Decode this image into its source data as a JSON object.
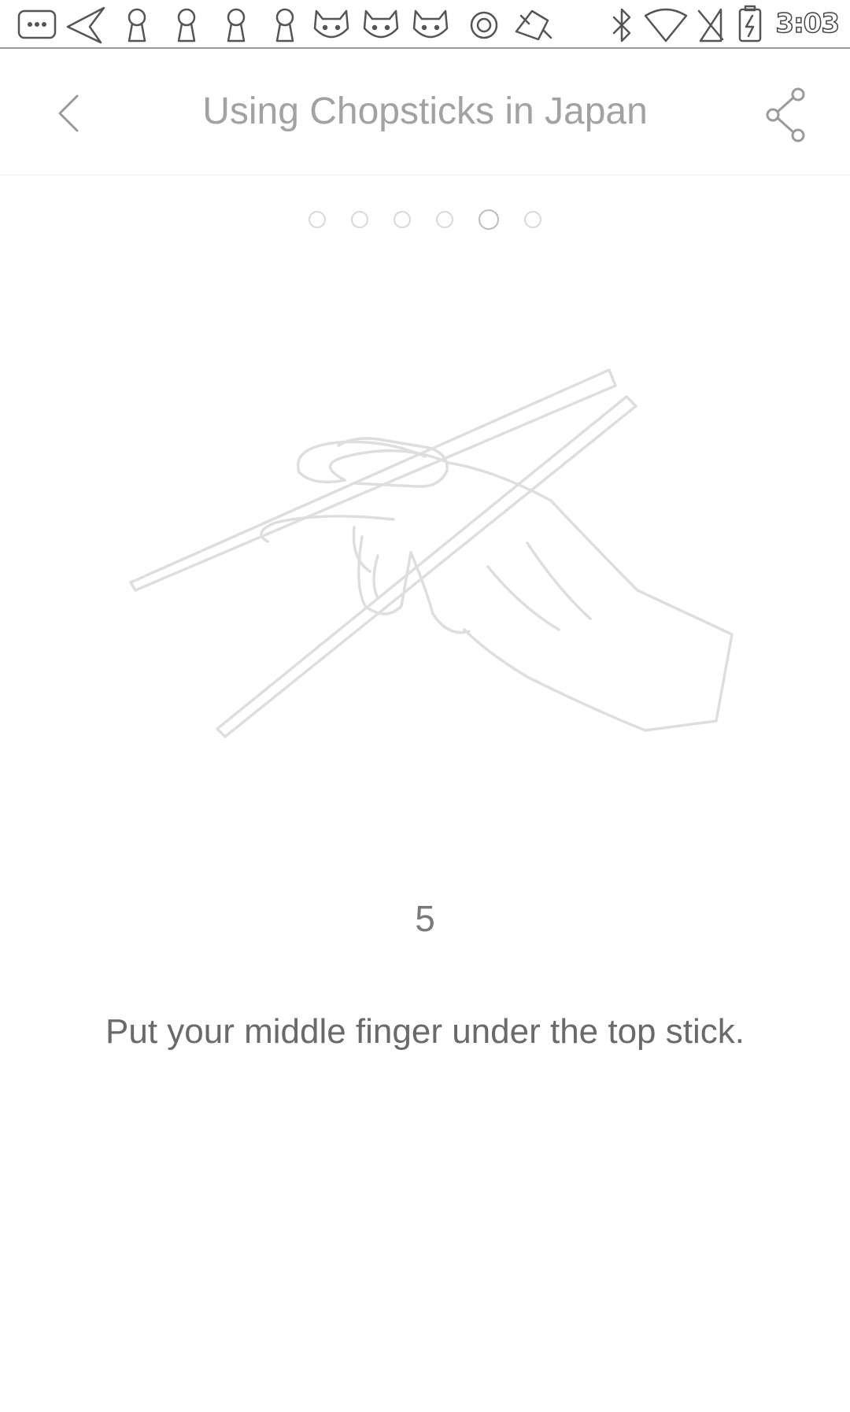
{
  "status_bar": {
    "time": "3:03",
    "left_icons": [
      "message-bubble-icon",
      "send-icon",
      "keyhole-icon",
      "keyhole-icon",
      "keyhole-icon",
      "keyhole-icon",
      "cat-face-icon",
      "cat-face-icon",
      "cat-face-icon",
      "circle-record-icon",
      "game-pad-icon"
    ],
    "right_icons": [
      "bluetooth-icon",
      "wifi-icon",
      "no-signal-icon",
      "battery-charging-icon"
    ]
  },
  "header": {
    "title": "Using Chopsticks in Japan",
    "back_icon": "chevron-left-icon",
    "share_icon": "share-icon"
  },
  "pager": {
    "total": 6,
    "current": 5
  },
  "step": {
    "number": "5",
    "instruction": "Put your middle finger under the top stick."
  },
  "colors": {
    "background": "#ffffff",
    "title": "#a2a2a2",
    "instruction": "#6a6a6a",
    "dot": "#d8d8d8"
  }
}
